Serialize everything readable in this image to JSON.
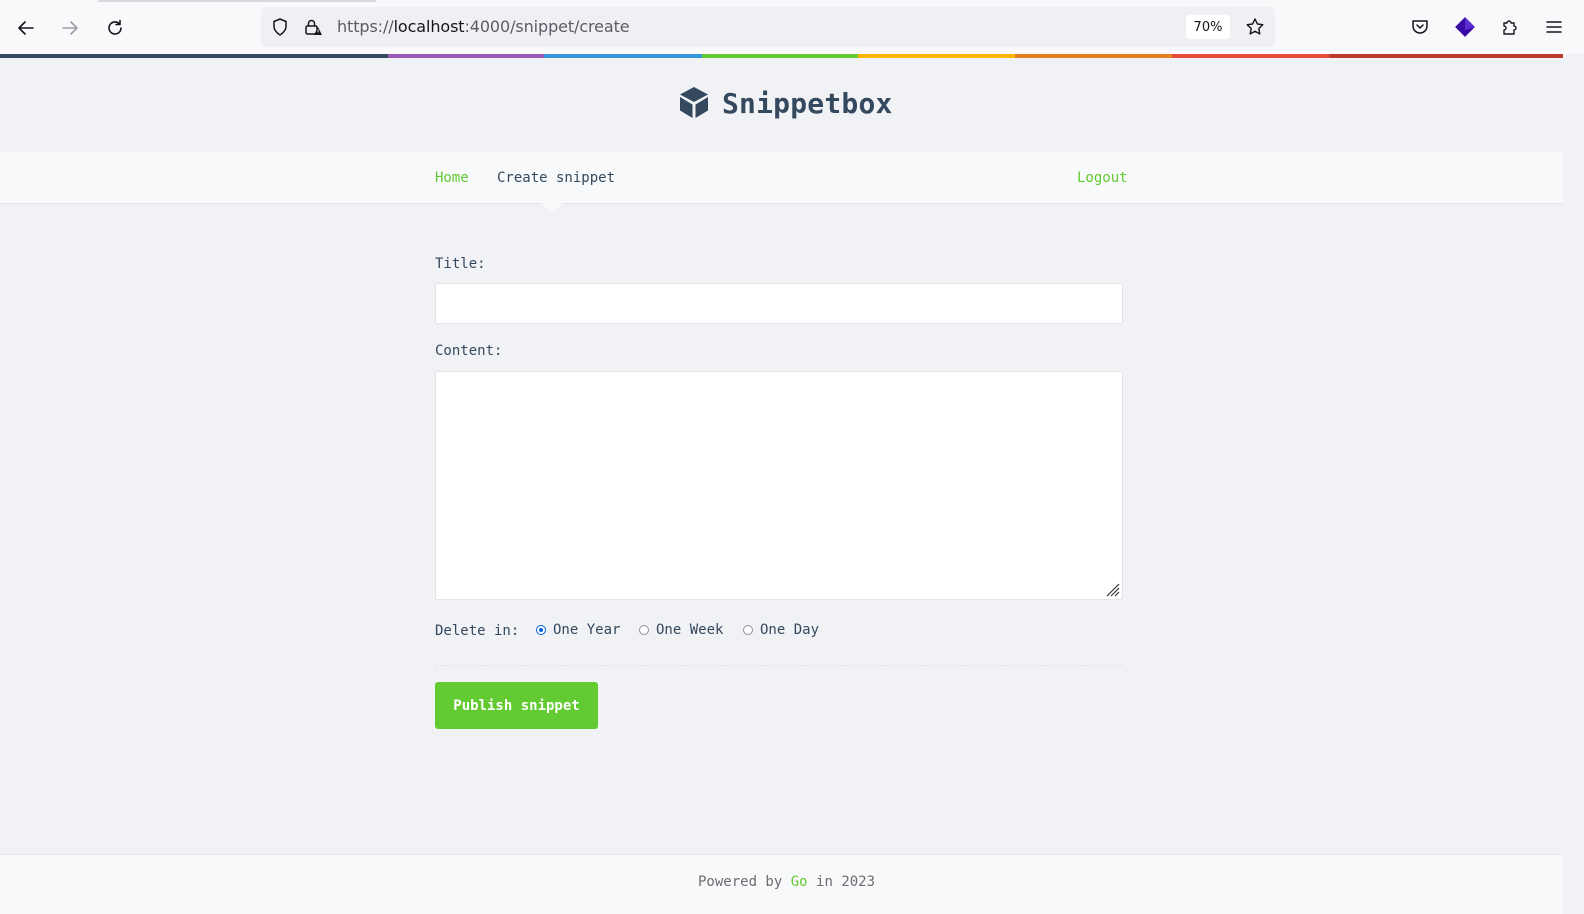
{
  "browser": {
    "url_prefix": "https://",
    "url_host": "localhost",
    "url_rest": ":4000/snippet/create",
    "zoom": "70%"
  },
  "site": {
    "brand": "Snippetbox",
    "rainbow_colors": [
      "#34495e",
      "#9b59b6",
      "#3498db",
      "#62cb31",
      "#ffb606",
      "#e67e22",
      "#e74c3c",
      "#c0392b"
    ]
  },
  "nav": {
    "home": "Home",
    "create": "Create snippet",
    "logout": "Logout"
  },
  "form": {
    "title_label": "Title:",
    "content_label": "Content:",
    "title_value": "",
    "content_value": "",
    "delete_label": "Delete in:",
    "expires_options": [
      {
        "label": "One Year",
        "checked": true
      },
      {
        "label": "One Week",
        "checked": false
      },
      {
        "label": "One Day",
        "checked": false
      }
    ],
    "submit_label": "Publish snippet"
  },
  "footer": {
    "prefix": "Powered by",
    "link": "Go",
    "suffix": "in 2023"
  },
  "colors": {
    "accent": "#62cb31",
    "text": "#34495e",
    "radio_checked": "#0060df"
  }
}
